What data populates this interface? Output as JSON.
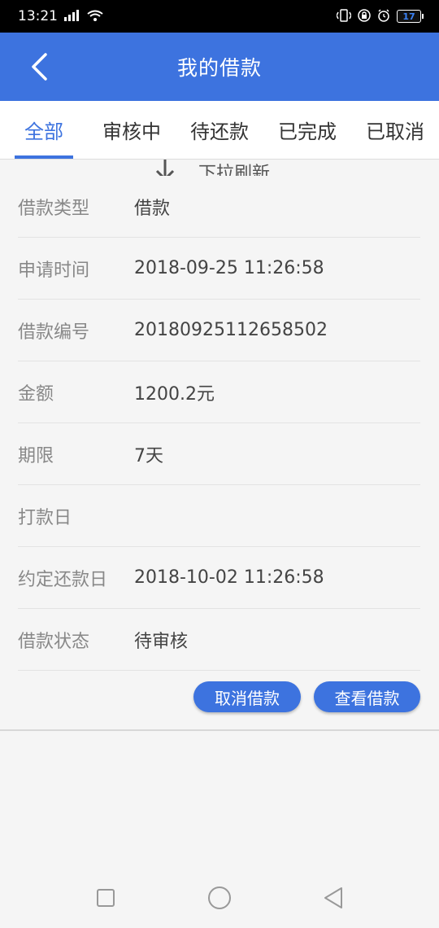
{
  "status_bar": {
    "time": "13:21",
    "battery": "17"
  },
  "app_bar": {
    "title": "我的借款"
  },
  "tabs": [
    {
      "label": "全部",
      "active": true
    },
    {
      "label": "审核中",
      "active": false
    },
    {
      "label": "待还款",
      "active": false
    },
    {
      "label": "已完成",
      "active": false
    },
    {
      "label": "已取消",
      "active": false
    }
  ],
  "refresh": {
    "text": "下拉刷新"
  },
  "loan": {
    "rows": [
      {
        "label": "借款类型",
        "value": "借款"
      },
      {
        "label": "申请时间",
        "value": "2018-09-25 11:26:58"
      },
      {
        "label": "借款编号",
        "value": "20180925112658502"
      },
      {
        "label": "金额",
        "value": "1200.2元"
      },
      {
        "label": "期限",
        "value": "7天"
      },
      {
        "label": "打款日",
        "value": ""
      },
      {
        "label": "约定还款日",
        "value": "2018-10-02 11:26:58"
      },
      {
        "label": "借款状态",
        "value": "待审核"
      }
    ],
    "cancel_button": "取消借款",
    "view_button": "查看借款"
  },
  "colors": {
    "primary": "#3d73df",
    "background": "#f5f5f5"
  }
}
